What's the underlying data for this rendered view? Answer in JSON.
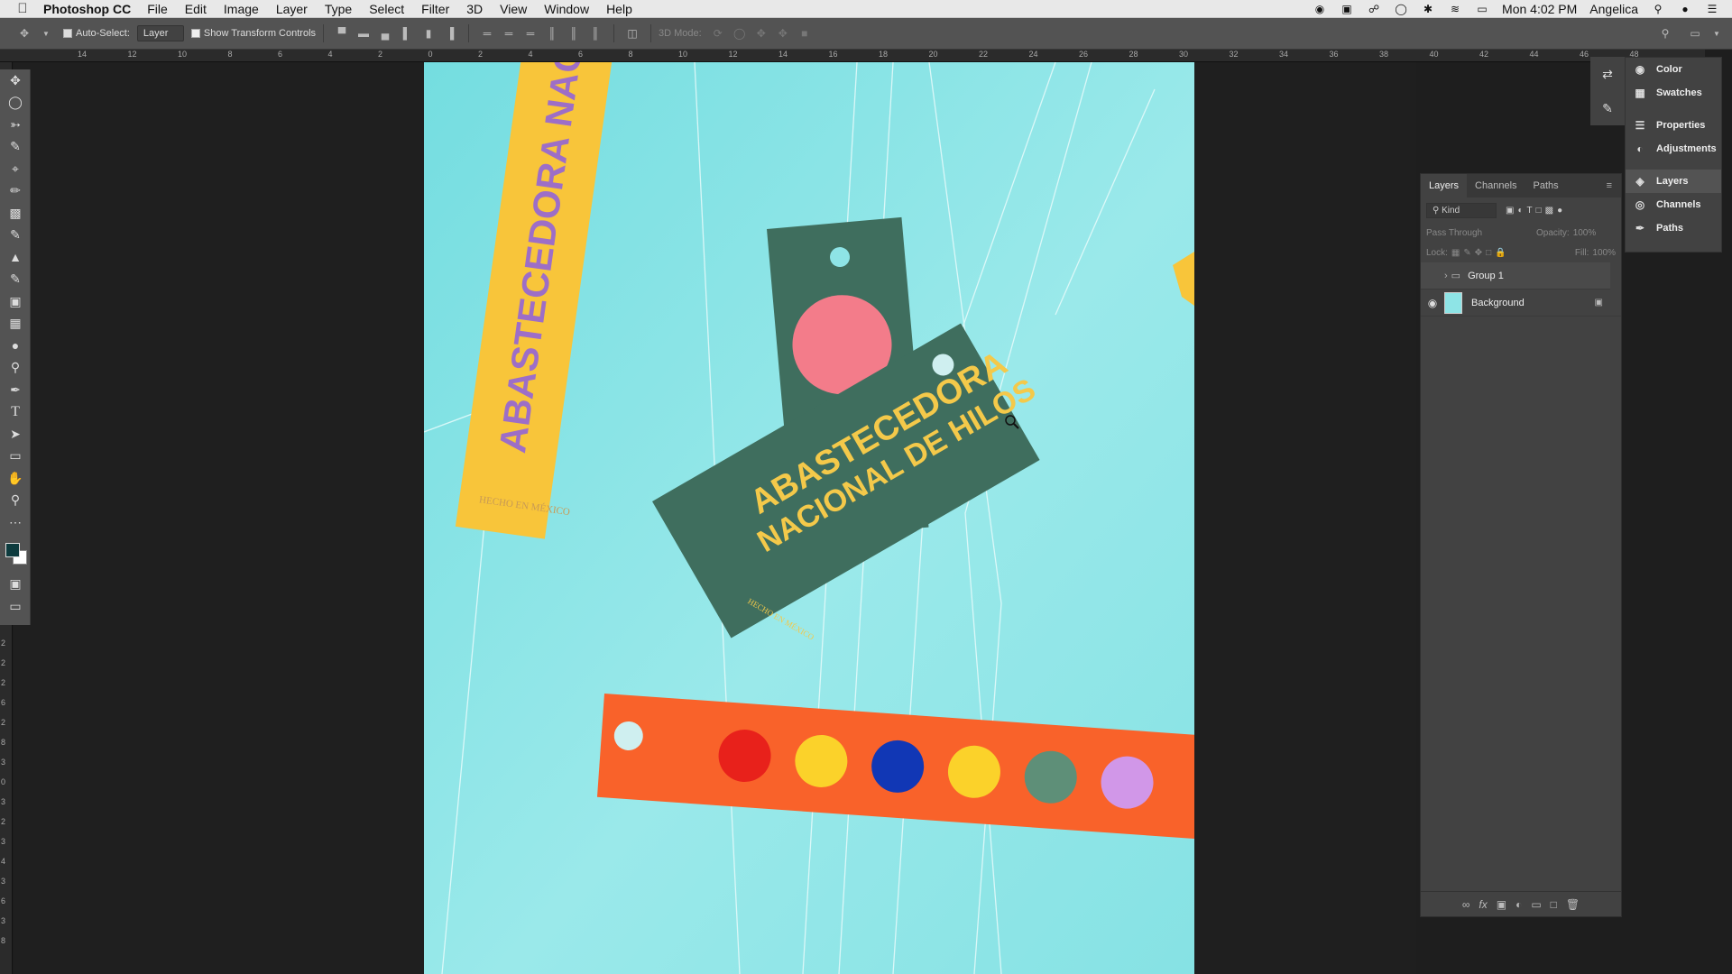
{
  "menubar": {
    "app_name": "Photoshop CC",
    "items": [
      "File",
      "Edit",
      "Image",
      "Layer",
      "Type",
      "Select",
      "Filter",
      "3D",
      "View",
      "Window",
      "Help"
    ],
    "clock": "Mon 4:02 PM",
    "user": "Angelica"
  },
  "options": {
    "auto_select_label": "Auto-Select:",
    "auto_select_value": "Layer",
    "show_transform_label": "Show Transform Controls",
    "mode_3d_label": "3D Mode:"
  },
  "rulers": {
    "h_numbers": [
      "14",
      "12",
      "10",
      "8",
      "6",
      "4",
      "2",
      "0",
      "2",
      "4",
      "6",
      "8",
      "10",
      "12",
      "14",
      "16",
      "18",
      "20",
      "22",
      "24",
      "26",
      "28",
      "30",
      "32",
      "34",
      "36",
      "38",
      "40",
      "42",
      "44",
      "46",
      "48"
    ],
    "v_numbers": [
      "2",
      "2",
      "2",
      "6",
      "2",
      "8",
      "3",
      "0",
      "3",
      "2",
      "3",
      "4",
      "3",
      "6",
      "3",
      "8"
    ]
  },
  "tools": [
    "move-tool",
    "marquee-tool",
    "lasso-tool",
    "quick-select-tool",
    "crop-tool",
    "eyedropper-tool",
    "healing-tool",
    "brush-tool",
    "stamp-tool",
    "history-brush-tool",
    "eraser-tool",
    "gradient-tool",
    "blur-tool",
    "dodge-tool",
    "pen-tool",
    "type-tool",
    "path-select-tool",
    "shape-tool",
    "hand-tool",
    "zoom-tool",
    "more-tools"
  ],
  "panel_menu": {
    "items": [
      {
        "label": "Color",
        "icon": "color-icon"
      },
      {
        "label": "Swatches",
        "icon": "swatches-icon"
      },
      {
        "label": "Properties",
        "icon": "properties-icon"
      },
      {
        "label": "Adjustments",
        "icon": "adjustments-icon"
      },
      {
        "label": "Layers",
        "icon": "layers-icon"
      },
      {
        "label": "Channels",
        "icon": "channels-icon"
      },
      {
        "label": "Paths",
        "icon": "paths-icon"
      }
    ]
  },
  "layers_panel": {
    "tabs": [
      "Layers",
      "Channels",
      "Paths"
    ],
    "filter_kind": "Kind",
    "blend_mode": "Pass Through",
    "opacity_label": "Opacity:",
    "opacity_value": "100%",
    "lock_label": "Lock:",
    "fill_label": "Fill:",
    "fill_value": "100%",
    "layers": [
      {
        "name": "Group 1",
        "type": "group"
      },
      {
        "name": "Background",
        "type": "image"
      }
    ]
  },
  "artwork": {
    "yellow_tag_text": "ABASTECEDORA NACIONAL DE HILOS",
    "yellow_tag_small": "HECHO EN MÉXICO",
    "green_tag_line1": "ABASTECEDORA",
    "green_tag_line2": "NACIONAL DE HILOS",
    "green_tag_small": "HECHO EN MÉXICO",
    "colors": {
      "background": "#8ee4e6",
      "yellow_tag": "#f8c53a",
      "green_tag": "#3f6e5e",
      "orange_tag": "#f9622a",
      "pink_circle": "#f37c8a",
      "purple_text": "#9d6ec7"
    },
    "dots": [
      "#e8211b",
      "#fbd22a",
      "#1137b5",
      "#fbd22a",
      "#5e8f78",
      "#d197e8"
    ]
  }
}
